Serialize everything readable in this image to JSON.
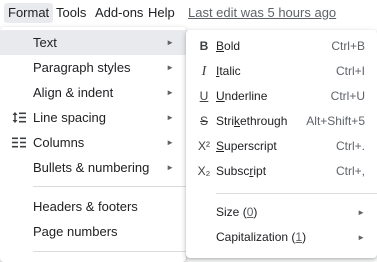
{
  "menubar": {
    "format": "Format",
    "tools": "Tools",
    "addons": "Add-ons",
    "help": "Help",
    "last_edit": "Last edit was 5 hours ago"
  },
  "format_menu": {
    "text": "Text",
    "paragraph_styles": "Paragraph styles",
    "align_indent": "Align & indent",
    "line_spacing": "Line spacing",
    "columns": "Columns",
    "bullets_numbering": "Bullets & numbering",
    "headers_footers": "Headers & footers",
    "page_numbers": "Page numbers"
  },
  "text_menu": {
    "bold": {
      "icon": "B",
      "pre": "",
      "mn": "B",
      "post": "old",
      "shortcut": "Ctrl+B"
    },
    "italic": {
      "icon": "I",
      "pre": "",
      "mn": "I",
      "post": "talic",
      "shortcut": "Ctrl+I"
    },
    "underline": {
      "icon": "U",
      "pre": "",
      "mn": "U",
      "post": "nderline",
      "shortcut": "Ctrl+U"
    },
    "strikethrough": {
      "icon": "S",
      "pre": "Stri",
      "mn": "k",
      "post": "ethrough",
      "shortcut": "Alt+Shift+5"
    },
    "superscript": {
      "icon": "X²",
      "pre": "",
      "mn": "S",
      "post": "uperscript",
      "shortcut": "Ctrl+."
    },
    "subscript": {
      "icon": "X₂",
      "pre": "Subsc",
      "mn": "r",
      "post": "ipt",
      "shortcut": "Ctrl+,"
    },
    "size": {
      "label": "Size",
      "paren_open": "(",
      "num": "0",
      "paren_close": ")"
    },
    "capitalization": {
      "label": "Capitalization",
      "paren_open": "(",
      "num": "1",
      "paren_close": ")"
    }
  },
  "arrow_glyph": "►",
  "colors": {
    "highlight": "#e8eaed",
    "text": "#202124",
    "muted": "#5f6368",
    "separator": "#dadce0"
  }
}
